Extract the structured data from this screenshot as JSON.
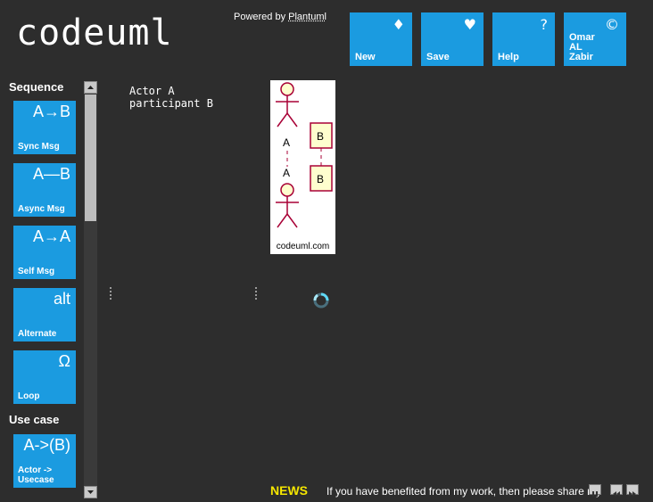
{
  "header": {
    "logo": "codeuml",
    "powered_prefix": "Powered by ",
    "powered_link": "Plantuml"
  },
  "toolbar": [
    {
      "label": "New",
      "icon": "♦",
      "icon_name": "diamond-icon"
    },
    {
      "label": "Save",
      "icon": "♥",
      "icon_name": "heart-icon"
    },
    {
      "label": "Help",
      "icon": "?",
      "icon_name": "question-icon"
    },
    {
      "label": "Omar AL Zabir",
      "icon": "©",
      "icon_name": "copyright-icon"
    }
  ],
  "sidebar": {
    "sections": [
      {
        "title": "Sequence",
        "items": [
          {
            "symbol": "A→B",
            "label": "Sync Msg"
          },
          {
            "symbol": "A—B",
            "label": "Async Msg"
          },
          {
            "symbol": "A→A",
            "label": "Self Msg"
          },
          {
            "symbol": "alt",
            "label": "Alternate"
          },
          {
            "symbol": "Ω",
            "label": "Loop"
          }
        ]
      },
      {
        "title": "Use case",
        "items": [
          {
            "symbol": "A->(B)",
            "label": "Actor -> Usecase"
          }
        ]
      }
    ]
  },
  "editor": {
    "code": "Actor A\nparticipant B"
  },
  "diagram": {
    "actor_label_top": "A",
    "actor_label_bottom": "A",
    "participant_top": "B",
    "participant_bottom": "B",
    "caption": "codeuml.com"
  },
  "news": {
    "label": "NEWS",
    "text": "If you have benefited from my work, then please share my"
  },
  "colors": {
    "background": "#2d2d2d",
    "tile": "#1b9be0",
    "news": "#f5e600",
    "actor": "#a80036",
    "participant_fill": "#fefece"
  }
}
